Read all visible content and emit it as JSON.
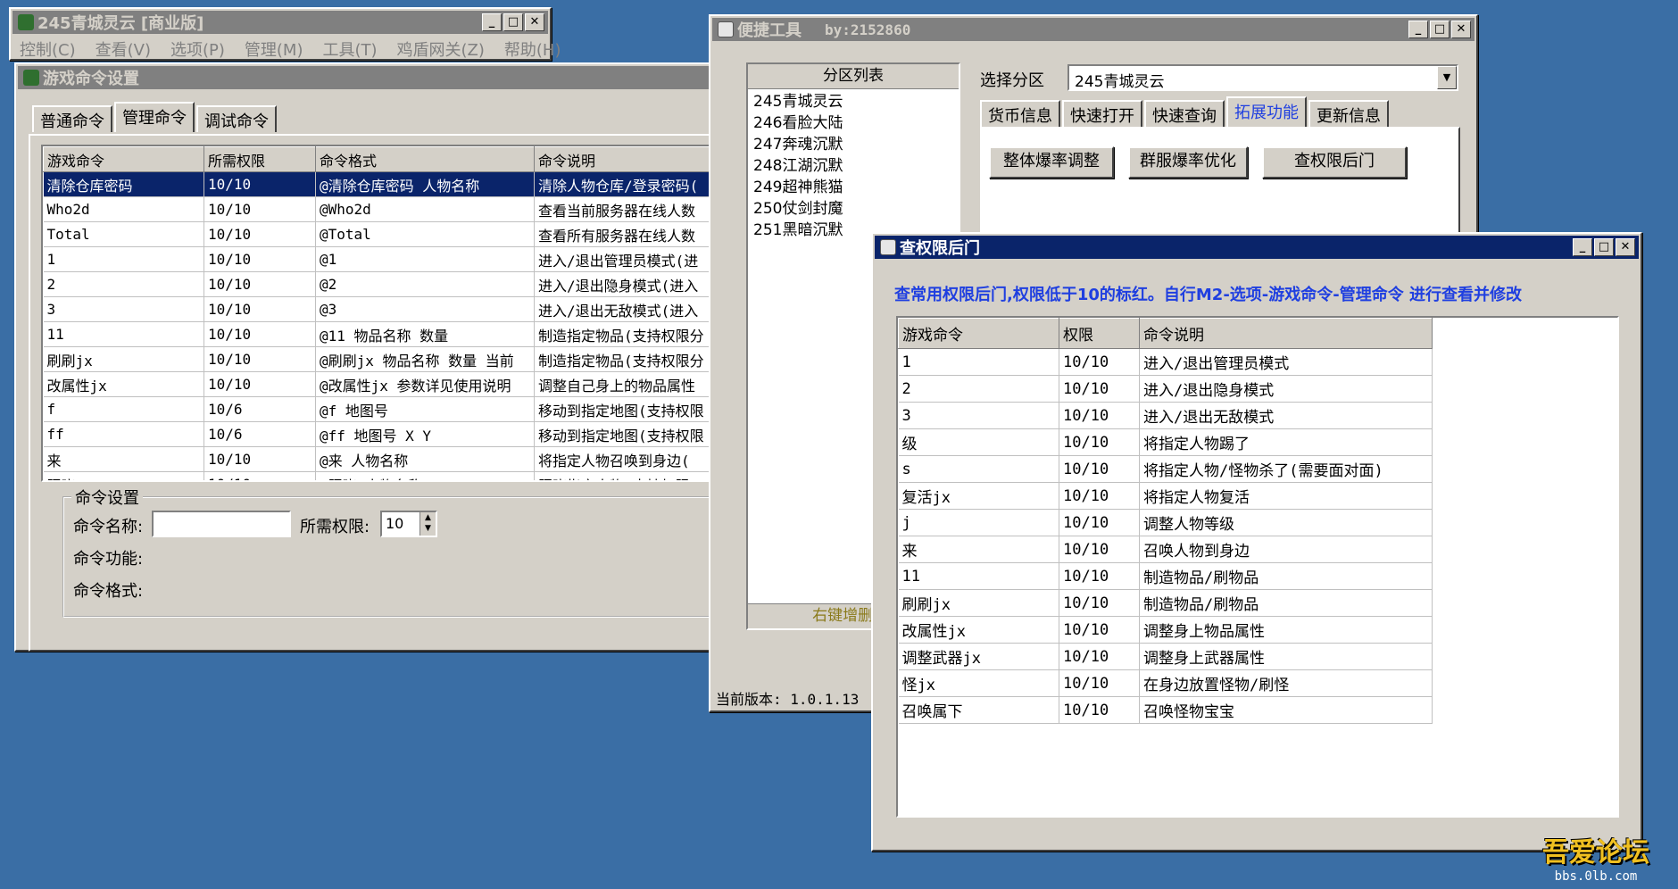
{
  "main_window": {
    "title": "245青城灵云 [商业版]",
    "menu": [
      "控制(C)",
      "查看(V)",
      "选项(P)",
      "管理(M)",
      "工具(T)",
      "鸡盾网关(Z)",
      "帮助(H)"
    ]
  },
  "game_cmd": {
    "title": "游戏命令设置",
    "tabs": [
      "普通命令",
      "管理命令",
      "调试命令"
    ],
    "selected_tab": 1,
    "columns": [
      "游戏命令",
      "所需权限",
      "命令格式",
      "命令说明"
    ],
    "rows": [
      [
        "清除仓库密码",
        "10/10",
        "@清除仓库密码 人物名称",
        "清除人物仓库/登录密码("
      ],
      [
        "Who2d",
        "10/10",
        "@Who2d",
        "查看当前服务器在线人数"
      ],
      [
        "Total",
        "10/10",
        "@Total",
        "查看所有服务器在线人数"
      ],
      [
        "1",
        "10/10",
        "@1",
        "进入/退出管理员模式(进"
      ],
      [
        "2",
        "10/10",
        "@2",
        "进入/退出隐身模式(进入"
      ],
      [
        "3",
        "10/10",
        "@3",
        "进入/退出无敌模式(进入"
      ],
      [
        "11",
        "10/10",
        "@11 物品名称 数量",
        "制造指定物品(支持权限分"
      ],
      [
        "刷刷jx",
        "10/10",
        "@刷刷jx 物品名称 数量 当前",
        "制造指定物品(支持权限分"
      ],
      [
        "改属性jx",
        "10/10",
        "@改属性jx 参数详见使用说明",
        "调整自己身上的物品属性"
      ],
      [
        "f",
        "10/6",
        "@f 地图号",
        "移动到指定地图(支持权限"
      ],
      [
        "ff",
        "10/6",
        "@ff 地图号 X Y",
        "移动到指定地图(支持权限"
      ],
      [
        "来",
        "10/10",
        "@来 人物名称",
        "将指定人物召唤到身边("
      ],
      [
        "照晓",
        "10/10",
        "@照晓 人物名称",
        "照晓指定人物(支持权限"
      ]
    ],
    "settings": {
      "group": "命令设置",
      "name_label": "命令名称:",
      "name_value": "",
      "perm_label": "所需权限:",
      "perm_value": "10",
      "func_label": "命令功能:",
      "format_label": "命令格式:"
    }
  },
  "tool": {
    "title": "便捷工具",
    "by": "by:2152860",
    "list_header": "分区列表",
    "list": [
      "245青城灵云",
      "246看脸大陆",
      "247奔魂沉默",
      "248江湖沉默",
      "249超神熊猫",
      "250仗剑封魔",
      "251黑暗沉默"
    ],
    "list_footer": "右键增删(支",
    "select_label": "选择分区",
    "select_value": "245青城灵云",
    "tabs": [
      "货币信息",
      "快速打开",
      "快速查询",
      "拓展功能",
      "更新信息"
    ],
    "selected_tab": 3,
    "buttons": [
      "整体爆率调整",
      "群服爆率优化",
      "查权限后门"
    ],
    "version": "当前版本: 1.0.1.13"
  },
  "perm": {
    "title": "查权限后门",
    "hint": "查常用权限后门,权限低于10的标红。自行M2-选项-游戏命令-管理命令 进行查看并修改",
    "columns": [
      "游戏命令",
      "权限",
      "命令说明"
    ],
    "rows": [
      [
        "1",
        "10/10",
        "进入/退出管理员模式"
      ],
      [
        "2",
        "10/10",
        "进入/退出隐身模式"
      ],
      [
        "3",
        "10/10",
        "进入/退出无敌模式"
      ],
      [
        "级",
        "10/10",
        "将指定人物踢了"
      ],
      [
        "s",
        "10/10",
        "将指定人物/怪物杀了(需要面对面)"
      ],
      [
        "复活jx",
        "10/10",
        "将指定人物复活"
      ],
      [
        "j",
        "10/10",
        "调整人物等级"
      ],
      [
        "来",
        "10/10",
        "召唤人物到身边"
      ],
      [
        "11",
        "10/10",
        "制造物品/刷物品"
      ],
      [
        "刷刷jx",
        "10/10",
        "制造物品/刷物品"
      ],
      [
        "改属性jx",
        "10/10",
        "调整身上物品属性"
      ],
      [
        "调整武器jx",
        "10/10",
        "调整身上武器属性"
      ],
      [
        "怪jx",
        "10/10",
        "在身边放置怪物/刷怪"
      ],
      [
        "召唤属下",
        "10/10",
        "召唤怪物宝宝"
      ]
    ]
  },
  "watermark": {
    "logo": "吾爱论坛",
    "url": "bbs.0lb.com"
  },
  "colors": {
    "desktop": "#3a6ea5",
    "active_title": "#0a246a",
    "hint_blue": "#1f3fe0"
  }
}
